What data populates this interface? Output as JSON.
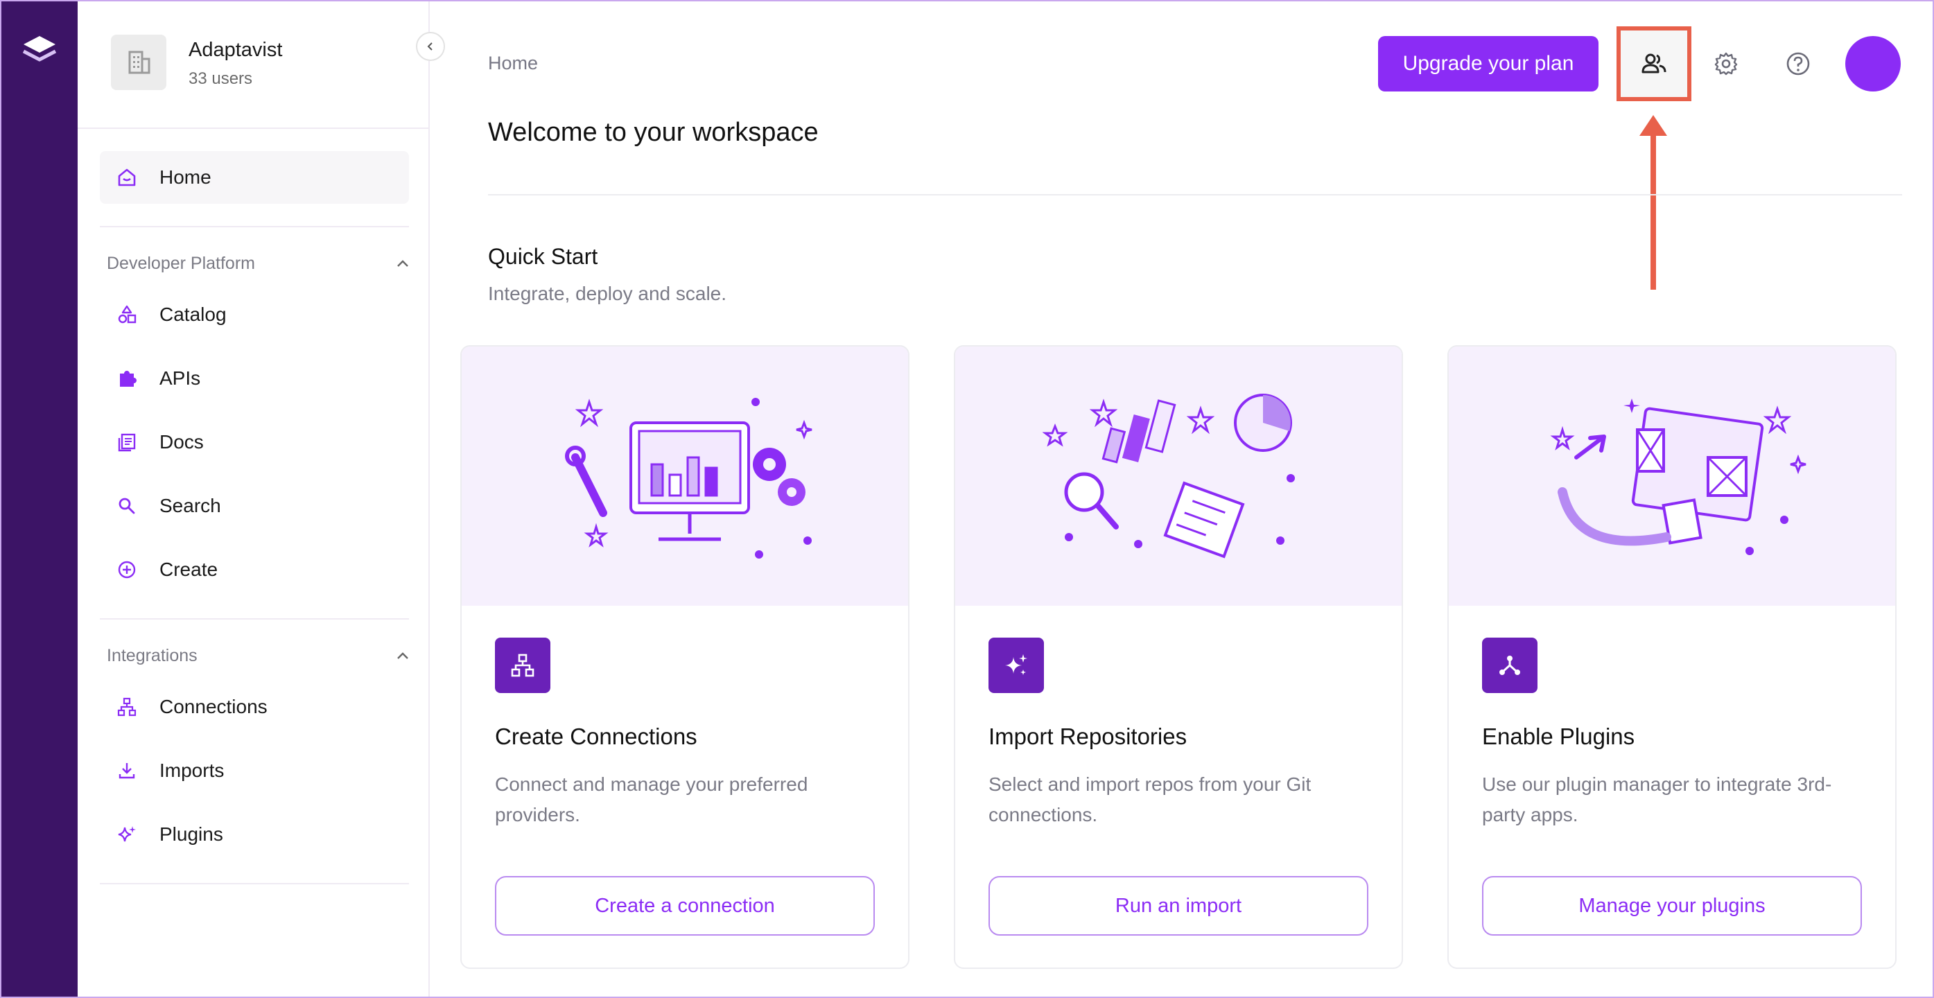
{
  "workspace": {
    "name": "Adaptavist",
    "users": "33 users"
  },
  "sidebar": {
    "home": "Home",
    "developer_platform": {
      "heading": "Developer Platform",
      "items": [
        {
          "label": "Catalog",
          "icon": "catalog-icon"
        },
        {
          "label": "APIs",
          "icon": "puzzle-icon"
        },
        {
          "label": "Docs",
          "icon": "docs-icon"
        },
        {
          "label": "Search",
          "icon": "search-icon"
        },
        {
          "label": "Create",
          "icon": "plus-circle-icon"
        }
      ]
    },
    "integrations": {
      "heading": "Integrations",
      "items": [
        {
          "label": "Connections",
          "icon": "hierarchy-icon"
        },
        {
          "label": "Imports",
          "icon": "download-icon"
        },
        {
          "label": "Plugins",
          "icon": "sparkle-icon"
        }
      ]
    }
  },
  "header": {
    "breadcrumb": "Home",
    "title": "Welcome to your workspace",
    "upgrade_label": "Upgrade your plan"
  },
  "quick_start": {
    "title": "Quick Start",
    "subtitle": "Integrate, deploy and scale.",
    "cards": [
      {
        "title": "Create Connections",
        "description": "Connect and manage your preferred providers.",
        "button": "Create a connection",
        "icon": "hierarchy-icon"
      },
      {
        "title": "Import Repositories",
        "description": "Select and import repos from your Git connections.",
        "button": "Run an import",
        "icon": "sparkle-icon"
      },
      {
        "title": "Enable Plugins",
        "description": "Use our plugin manager to integrate 3rd-party apps.",
        "button": "Manage your plugins",
        "icon": "plugin-fork-icon"
      }
    ]
  },
  "colors": {
    "accent": "#8b2cf5",
    "rail": "#3c1466",
    "annotation": "#e8604a"
  }
}
